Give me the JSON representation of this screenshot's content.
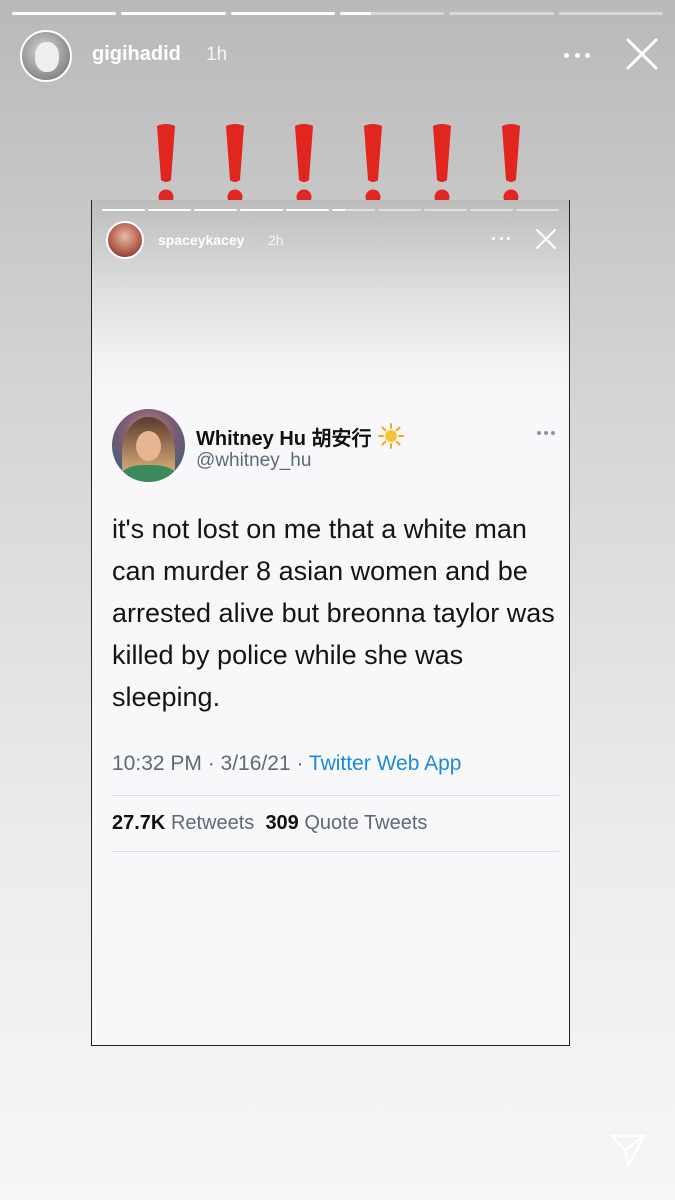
{
  "story": {
    "username": "gigihadid",
    "time": "1h",
    "progress": [
      1,
      1,
      1,
      0.3,
      0,
      0
    ]
  },
  "sticker": {
    "glyph": "!",
    "count": 6,
    "color": "#e0261f"
  },
  "shared_story": {
    "username": "spaceykacey",
    "time": "2h",
    "progress": [
      1,
      1,
      1,
      1,
      1,
      0.3,
      0,
      0,
      0,
      0
    ]
  },
  "tweet": {
    "display_name": "Whitney Hu 胡安行",
    "handle": "@whitney_hu",
    "text": "it's not lost on me that a white man can murder 8 asian women and be arrested alive but breonna taylor was killed by police while she was sleeping.",
    "timestamp": "10:32 PM · 3/16/21 ·",
    "source": "Twitter Web App",
    "retweets_count": "27.7K",
    "retweets_label": "Retweets",
    "quotes_count": "309",
    "quotes_label": "Quote Tweets"
  },
  "colors": {
    "twitter_blue": "#1d8ad8",
    "secondary_text": "#5b6b78",
    "alert_red": "#e0261f"
  },
  "icons": {
    "more_outer": "more-horizontal-icon",
    "close_outer": "close-icon",
    "more_inner": "more-horizontal-icon",
    "close_inner": "close-icon",
    "verified_emoji": "sun-icon",
    "share": "send-icon"
  }
}
